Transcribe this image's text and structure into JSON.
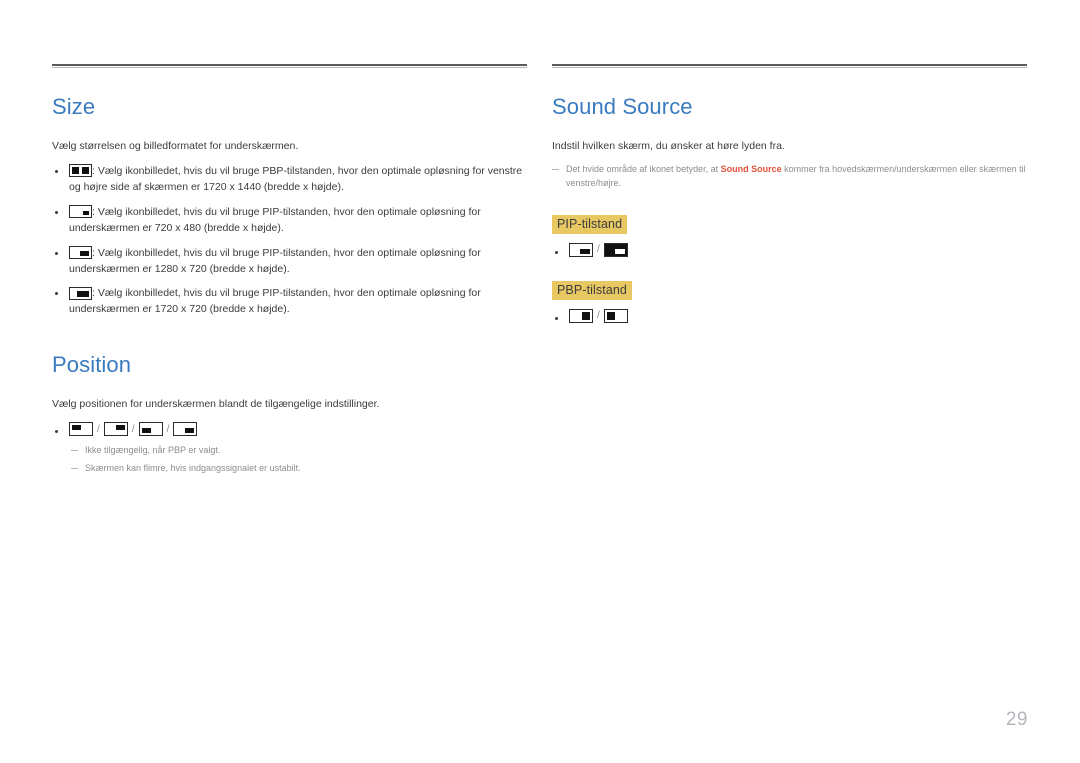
{
  "page": {
    "number": "29"
  },
  "left_column": {
    "size_section": {
      "title": "Size",
      "lead": "Vælg størrelsen og billedformatet for underskærmen.",
      "bullets": [
        {
          "icon": "pbp-split-icon",
          "text": ": Vælg ikonbilledet, hvis du vil bruge PBP-tilstanden, hvor den optimale opløsning for venstre og højre side af skærmen er 1720 x 1440 (bredde x højde)."
        },
        {
          "icon": "pip-xsmall-icon",
          "text": ": Vælg ikonbilledet, hvis du vil bruge PIP-tilstanden, hvor den optimale opløsning for underskærmen er 720 x 480 (bredde x højde)."
        },
        {
          "icon": "pip-small-icon",
          "text": ": Vælg ikonbilledet, hvis du vil bruge PIP-tilstanden, hvor den optimale opløsning for underskærmen er 1280 x 720 (bredde x højde)."
        },
        {
          "icon": "pip-medium-icon",
          "text": ": Vælg ikonbilledet, hvis du vil bruge PIP-tilstanden, hvor den optimale opløsning for underskærmen er 1720 x 720 (bredde x højde)."
        }
      ]
    },
    "position_section": {
      "title": "Position",
      "lead": "Vælg positionen for underskærmen blandt de tilgængelige indstillinger.",
      "icons": [
        "position-top-left-icon",
        "position-top-right-icon",
        "position-bottom-left-icon",
        "position-bottom-right-icon"
      ],
      "separator": "/",
      "notes": [
        "Ikke tilgængelig, når PBP er valgt.",
        "Skærmen kan flimre, hvis indgangssignalet er ustabilt."
      ]
    }
  },
  "right_column": {
    "sound_source_section": {
      "title": "Sound Source",
      "lead": "Indstil hvilken skærm, du ønsker at høre lyden fra.",
      "note": {
        "before": "Det hvide område af ikonet betyder, at ",
        "highlight": "Sound Source",
        "after": " kommer fra hovedskærmen/underskærmen eller skærmen til venstre/højre."
      },
      "pip_mode": {
        "label": "PIP-tilstand",
        "separator": "/",
        "icons": [
          "sound-source-pip-main-icon",
          "sound-source-pip-sub-icon"
        ]
      },
      "pbp_mode": {
        "label": "PBP-tilstand",
        "separator": "/",
        "icons": [
          "sound-source-pbp-right-icon",
          "sound-source-pbp-left-icon"
        ]
      }
    }
  },
  "colors": {
    "heading_blue": "#3a7bbf",
    "highlight_gold": "#e8c863",
    "accent_red": "#e0543a",
    "rule_gray": "#5a5a5a",
    "note_gray": "#8d8d8d",
    "page_number_gray": "#b3b6bb"
  }
}
